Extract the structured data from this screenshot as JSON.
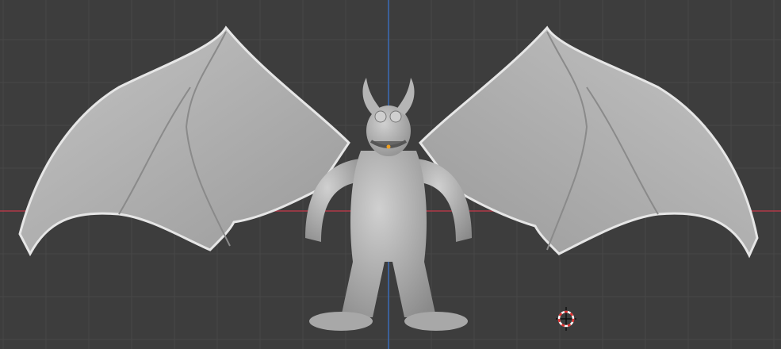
{
  "viewport": {
    "background_color": "#3d3d3d",
    "grid_color": "#484848",
    "x_axis_color": "#b03a48",
    "z_axis_color": "#3b6db8",
    "model_color": "#b9b9b9",
    "model_shadow_color": "#8e8e8e",
    "origin_color": "#f0a020",
    "cursor_colors": [
      "#e03030",
      "#ffffff"
    ]
  },
  "icons": [
    "3d-cursor-icon",
    "object-origin-icon"
  ]
}
